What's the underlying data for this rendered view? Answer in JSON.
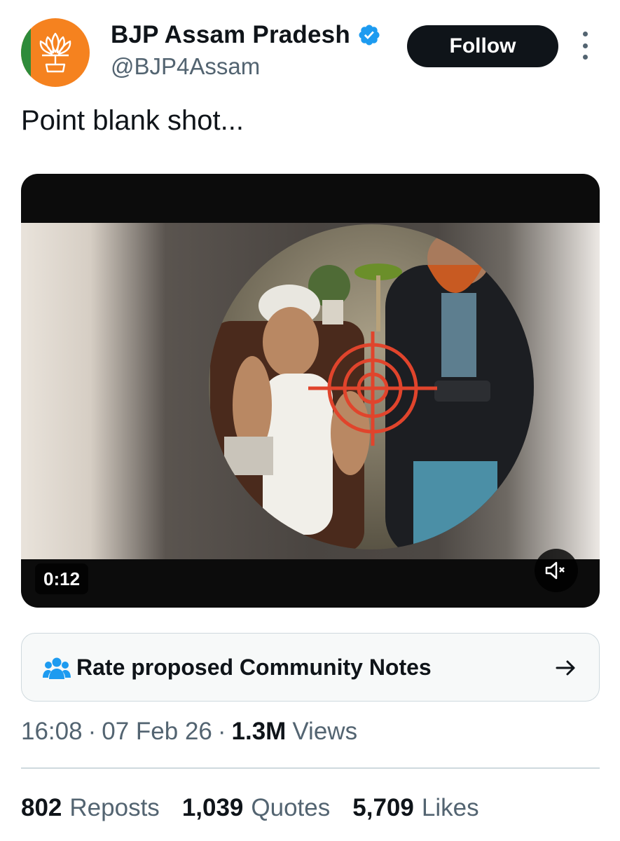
{
  "author": {
    "display_name": "BJP Assam Pradesh",
    "handle": "@BJP4Assam",
    "verified": true,
    "avatar_icon": "bjp-lotus-logo",
    "follow_label": "Follow"
  },
  "tweet": {
    "text": "Point blank shot..."
  },
  "media": {
    "type": "video",
    "duration": "0:12",
    "muted": true
  },
  "community_notes": {
    "label": "Rate proposed Community Notes",
    "icon": "people-icon",
    "arrow_icon": "arrow-right-icon"
  },
  "meta": {
    "time": "16:08",
    "date": "07 Feb 26",
    "views_count": "1.3M",
    "views_label": "Views",
    "separator": "·"
  },
  "stats": {
    "reposts_count": "802",
    "reposts_label": "Reposts",
    "quotes_count": "1,039",
    "quotes_label": "Quotes",
    "likes_count": "5,709",
    "likes_label": "Likes"
  },
  "colors": {
    "accent_blue": "#1d9bf0",
    "text_primary": "#0f1419",
    "text_secondary": "#536471",
    "target_red": "#e0442c",
    "avatar_orange": "#f5821f"
  }
}
